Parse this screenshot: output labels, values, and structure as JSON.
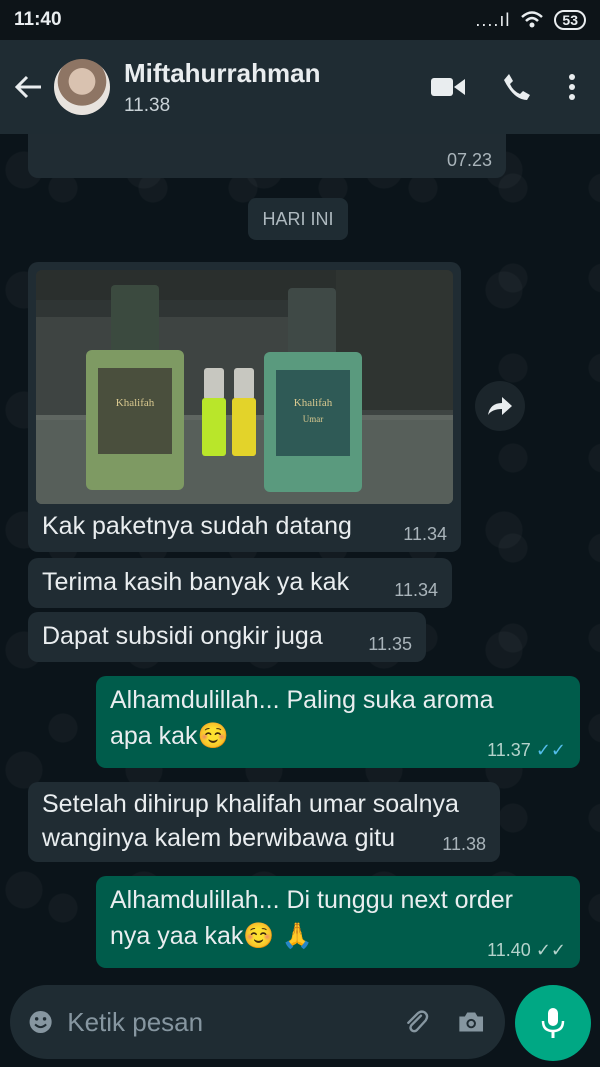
{
  "status_bar": {
    "time": "11:40",
    "signal": "....ıl",
    "battery": "53"
  },
  "header": {
    "contact_name": "Miftahurrahman",
    "last_seen": "11.38"
  },
  "chat": {
    "partial_message": {
      "time": "07.23"
    },
    "date_divider": "HARI INI",
    "image_message": {
      "photo_label_left": "Khalifah",
      "photo_label_right": "Khalifah",
      "photo_sub_right": "Umar"
    },
    "messages": [
      {
        "text": "Kak paketnya sudah datang",
        "time": "11.34",
        "direction": "in"
      },
      {
        "text": "Terima kasih banyak ya kak",
        "time": "11.34",
        "direction": "in"
      },
      {
        "text": "Dapat subsidi ongkir juga",
        "time": "11.35",
        "direction": "in"
      },
      {
        "text_line1": "Alhamdulillah... Paling suka aroma",
        "text_line2": "apa kak☺️",
        "time": "11.37",
        "direction": "out",
        "status": "read"
      },
      {
        "text_line1": "Setelah dihirup khalifah umar soalnya",
        "text_line2": "wanginya kalem berwibawa gitu",
        "time": "11.38",
        "direction": "in"
      },
      {
        "text_line1": "Alhamdulillah... Di tunggu next order",
        "text_line2": "nya yaa kak☺️ 🙏",
        "time": "11.40",
        "direction": "out",
        "status": "delivered"
      }
    ]
  },
  "composer": {
    "placeholder": "Ketik pesan"
  },
  "icons": {
    "back": "arrow-left-icon",
    "video": "video-camera-icon",
    "call": "phone-icon",
    "menu": "more-vertical-icon",
    "forward": "forward-icon",
    "emoji": "emoji-icon",
    "attach": "paperclip-icon",
    "camera": "camera-icon",
    "mic": "mic-icon"
  },
  "colors": {
    "incoming": "#202c33",
    "outgoing": "#005c4b",
    "header": "#1f2c33",
    "accent": "#00a884",
    "read_tick": "#53bdeb"
  }
}
